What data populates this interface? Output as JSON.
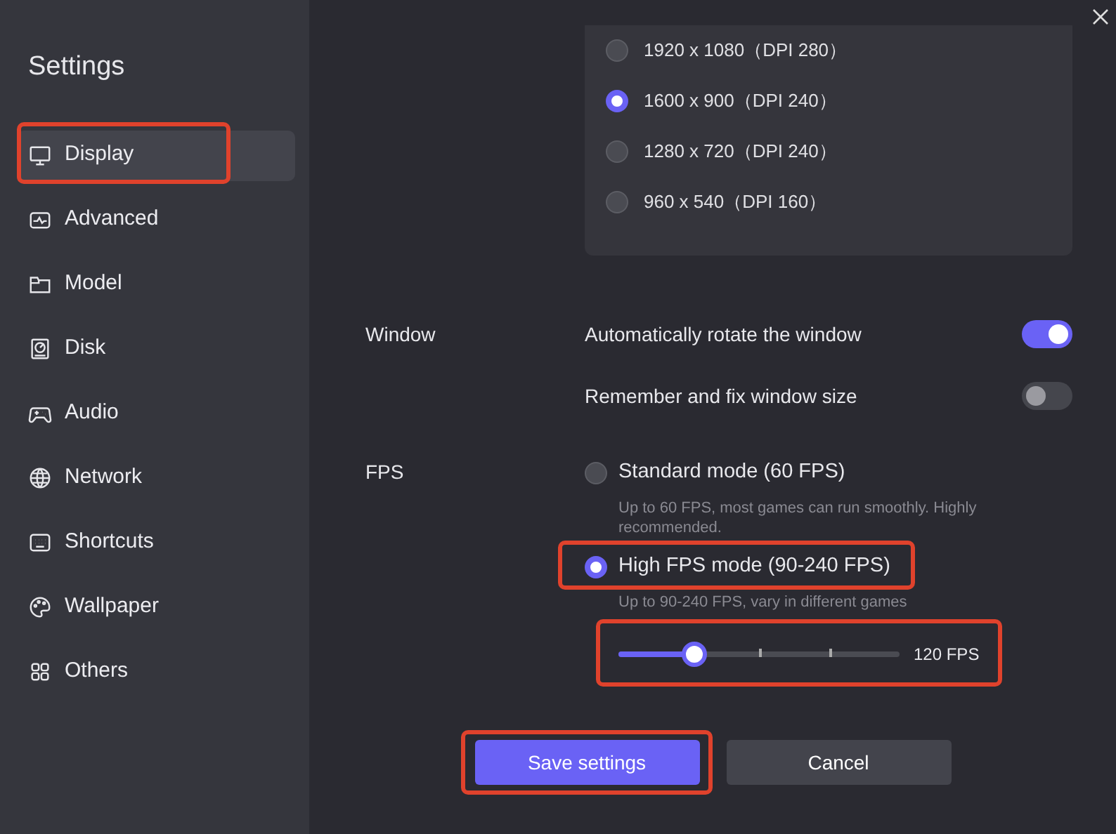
{
  "sidebar": {
    "title": "Settings",
    "items": [
      {
        "label": "Display",
        "selected": true,
        "highlighted": true
      },
      {
        "label": "Advanced",
        "selected": false,
        "highlighted": false
      },
      {
        "label": "Model",
        "selected": false,
        "highlighted": false
      },
      {
        "label": "Disk",
        "selected": false,
        "highlighted": false
      },
      {
        "label": "Audio",
        "selected": false,
        "highlighted": false
      },
      {
        "label": "Network",
        "selected": false,
        "highlighted": false
      },
      {
        "label": "Shortcuts",
        "selected": false,
        "highlighted": false
      },
      {
        "label": "Wallpaper",
        "selected": false,
        "highlighted": false
      },
      {
        "label": "Others",
        "selected": false,
        "highlighted": false
      }
    ]
  },
  "resolutions": [
    {
      "label": "1920 x 1080（DPI 280）",
      "selected": false
    },
    {
      "label": "1600 x 900（DPI 240）",
      "selected": true
    },
    {
      "label": "1280 x 720（DPI 240）",
      "selected": false
    },
    {
      "label": "960 x 540（DPI 160）",
      "selected": false
    }
  ],
  "window_section": {
    "label": "Window",
    "options": [
      {
        "label": "Automatically rotate the window",
        "on": true
      },
      {
        "label": "Remember and fix window size",
        "on": false
      }
    ]
  },
  "fps_section": {
    "label": "FPS",
    "options": [
      {
        "label": "Standard mode (60 FPS)",
        "description": "Up to 60 FPS, most games can run smoothly. Highly recommended.",
        "selected": false,
        "highlighted": false
      },
      {
        "label": "High FPS mode (90-240 FPS)",
        "description": "Up to 90-240 FPS, vary in different games",
        "selected": true,
        "highlighted": true
      }
    ],
    "slider": {
      "level": 0.27,
      "reading": "120 FPS",
      "highlighted": true
    }
  },
  "buttons": [
    {
      "label": "Save settings",
      "kind": "primary",
      "highlighted": true
    },
    {
      "label": "Cancel",
      "kind": "secondary",
      "highlighted": false
    }
  ]
}
